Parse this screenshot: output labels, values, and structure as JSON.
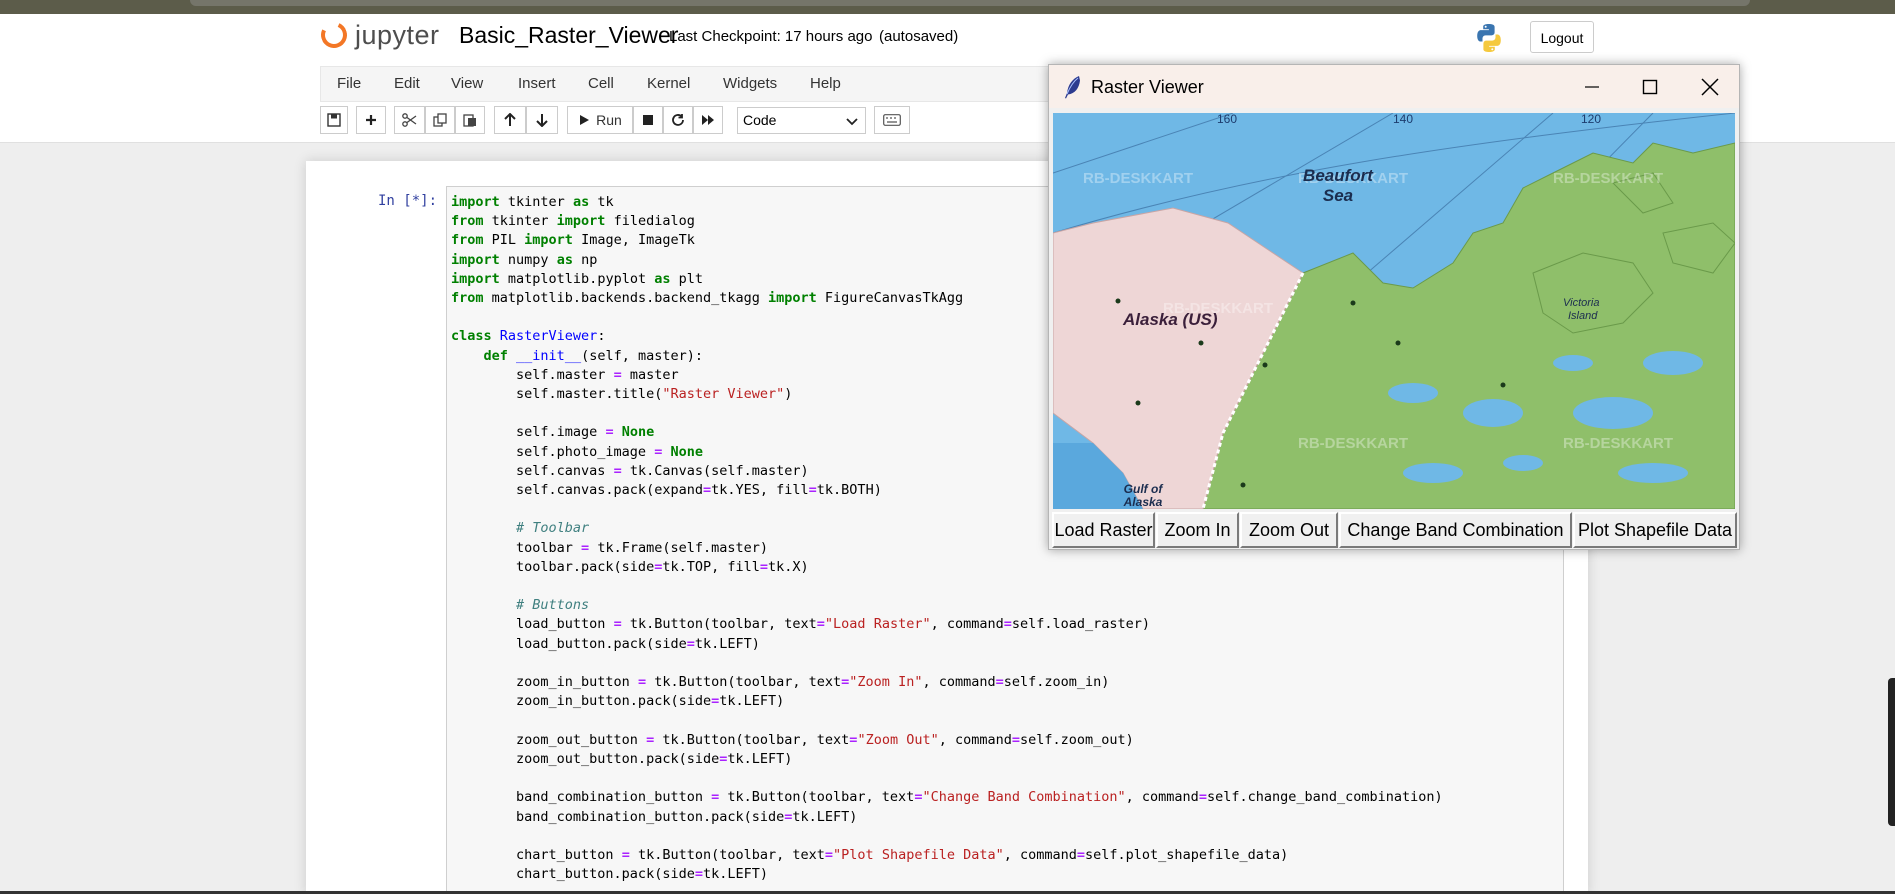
{
  "header": {
    "logo_text": "jupyter",
    "notebook_name": "Basic_Raster_Viewer",
    "checkpoint": "Last Checkpoint: 17 hours ago",
    "autosave_status": "(autosaved)",
    "logout_label": "Logout"
  },
  "menu": [
    "File",
    "Edit",
    "View",
    "Insert",
    "Cell",
    "Kernel",
    "Widgets",
    "Help"
  ],
  "toolbar": {
    "run_label": "Run",
    "cell_type": "Code"
  },
  "cell": {
    "prompt": "In [*]:"
  },
  "tk_window": {
    "title": "Raster Viewer",
    "buttons": [
      "Load Raster",
      "Zoom In",
      "Zoom Out",
      "Change Band Combination",
      "Plot Shapefile Data"
    ],
    "map": {
      "labels": {
        "sea": "Beaufort",
        "sea2": "Sea",
        "alaska": "Alaska (US)",
        "gulf": "Gulf of",
        "gulf2": "Alaska",
        "victoria": "Victoria",
        "victoria2": "Island",
        "watermark": "RB-DESKKART"
      },
      "longitudes": [
        "160",
        "140",
        "120"
      ]
    }
  },
  "colors": {
    "jupyter_orange": "#f37726",
    "prompt_blue": "#303f9f",
    "water": "#6fb8e6",
    "land_canada": "#8fbf6a",
    "land_alaska": "#eed6d6"
  }
}
